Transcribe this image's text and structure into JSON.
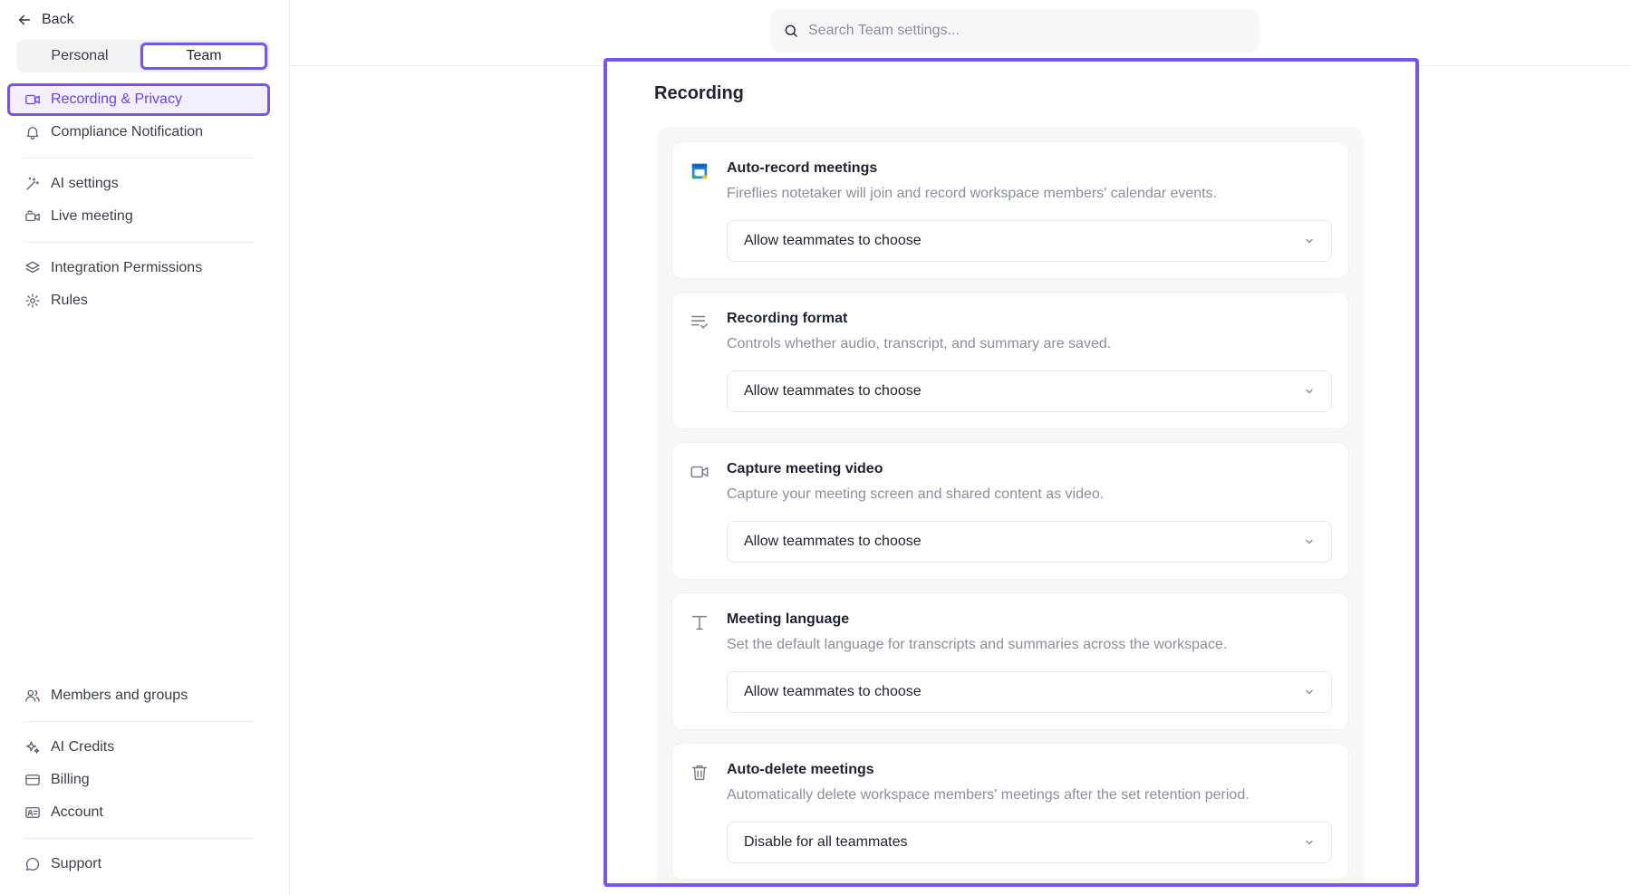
{
  "sidebar": {
    "back_label": "Back",
    "tabs": [
      {
        "label": "Personal",
        "active": false
      },
      {
        "label": "Team",
        "active": true
      }
    ],
    "groups": [
      [
        {
          "label": "Recording & Privacy",
          "icon": "video-camera-icon",
          "active": true
        },
        {
          "label": "Compliance Notification",
          "icon": "bell-icon",
          "active": false
        }
      ],
      [
        {
          "label": "AI settings",
          "icon": "magic-wand-icon",
          "active": false
        },
        {
          "label": "Live meeting",
          "icon": "live-camera-icon",
          "active": false
        }
      ],
      [
        {
          "label": "Integration Permissions",
          "icon": "layers-icon",
          "active": false
        },
        {
          "label": "Rules",
          "icon": "settings-gear-icon",
          "active": false
        }
      ]
    ],
    "bottom_groups": [
      [
        {
          "label": "Members and groups",
          "icon": "users-icon"
        }
      ],
      [
        {
          "label": "AI Credits",
          "icon": "sparkles-icon"
        },
        {
          "label": "Billing",
          "icon": "credit-card-icon"
        },
        {
          "label": "Account",
          "icon": "id-card-icon"
        }
      ],
      [
        {
          "label": "Support",
          "icon": "chat-bubble-icon"
        }
      ]
    ]
  },
  "search": {
    "placeholder": "Search Team settings..."
  },
  "main": {
    "section_title": "Recording",
    "cards": [
      {
        "title": "Auto-record meetings",
        "description": "Fireflies notetaker will join and record workspace members' calendar events.",
        "icon": "calendar-icon",
        "select_value": "Allow teammates to choose"
      },
      {
        "title": "Recording format",
        "description": "Controls whether audio, transcript, and summary are saved.",
        "icon": "list-check-icon",
        "select_value": "Allow teammates to choose"
      },
      {
        "title": "Capture meeting video",
        "description": "Capture your meeting screen and shared content as video.",
        "icon": "video-camera-icon",
        "select_value": "Allow teammates to choose"
      },
      {
        "title": "Meeting language",
        "description": "Set the default language for transcripts and summaries across the workspace.",
        "icon": "text-type-icon",
        "select_value": "Allow teammates to choose"
      },
      {
        "title": "Auto-delete meetings",
        "description": "Automatically delete workspace members' meetings after the set retention period.",
        "icon": "trash-icon",
        "select_value": "Disable for all teammates"
      }
    ]
  },
  "colors": {
    "accent": "#7657ee",
    "active_text": "#6a44e8",
    "muted_text": "#8a8f9b"
  }
}
